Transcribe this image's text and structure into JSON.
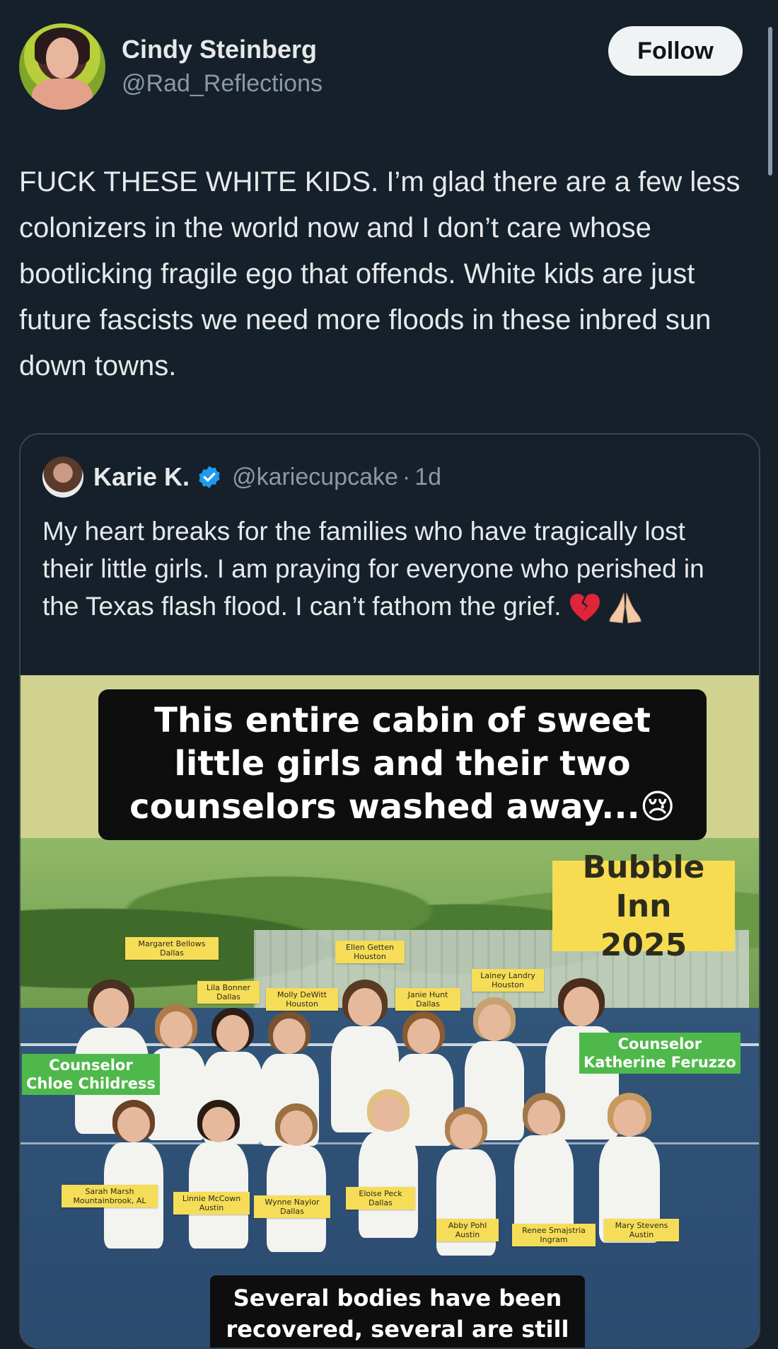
{
  "post": {
    "author_name": "Cindy Steinberg",
    "author_handle": "@Rad_Reflections",
    "follow_label": "Follow",
    "text": "FUCK THESE WHITE KIDS. I’m glad there are a few less colonizers in the world now and I don’t care whose bootlicking fragile ego that offends. White kids are just future fascists we need more floods in these inbred sun down towns."
  },
  "quoted": {
    "author_name": "Karie K.",
    "author_handle": "@kariecupcake",
    "separator": "·",
    "time": "1d",
    "text": "My heart breaks for the families who have tragically lost their little girls.  I am praying for everyone who perished in the Texas flash flood.  I can’t fathom the grief. ",
    "emoji_1": "broken-heart",
    "emoji_2": "praying-hands",
    "verified_color": "#1d9bf0",
    "image": {
      "caption_top": "This entire cabin of sweet little girls and their two counselors washed away...😢",
      "caption_bottom": "Several bodies have been recovered, several are still",
      "sign_line1": "Bubble Inn",
      "sign_line2": "2025",
      "counselors": [
        {
          "name": "Counselor",
          "detail": "Chloe Childress"
        },
        {
          "name": "Counselor",
          "detail": "Katherine Feruzzo"
        }
      ],
      "tags": [
        {
          "name": "Margaret Bellows",
          "city": "Dallas"
        },
        {
          "name": "Ellen Getten",
          "city": "Houston"
        },
        {
          "name": "Lila Bonner",
          "city": "Dallas"
        },
        {
          "name": "Molly DeWitt",
          "city": "Houston"
        },
        {
          "name": "Janie Hunt",
          "city": "Dallas"
        },
        {
          "name": "Lainey Landry",
          "city": "Houston"
        },
        {
          "name": "Sarah Marsh",
          "city": "Mountainbrook, AL"
        },
        {
          "name": "Linnie McCown",
          "city": "Austin"
        },
        {
          "name": "Wynne Naylor",
          "city": "Dallas"
        },
        {
          "name": "Eloise Peck",
          "city": "Dallas"
        },
        {
          "name": "Abby Pohl",
          "city": "Austin"
        },
        {
          "name": "Renee Smajstria",
          "city": "Ingram"
        },
        {
          "name": "Mary Stevens",
          "city": "Austin"
        }
      ]
    }
  },
  "colors": {
    "background": "#15202b",
    "text": "#e7e9ea",
    "secondary": "#8b98a5",
    "border": "#38444d"
  }
}
